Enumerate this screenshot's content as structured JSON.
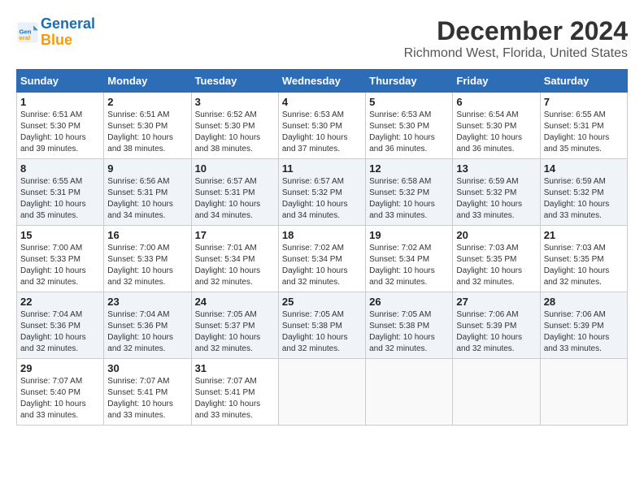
{
  "header": {
    "logo_line1": "General",
    "logo_line2": "Blue",
    "month": "December 2024",
    "location": "Richmond West, Florida, United States"
  },
  "days_of_week": [
    "Sunday",
    "Monday",
    "Tuesday",
    "Wednesday",
    "Thursday",
    "Friday",
    "Saturday"
  ],
  "weeks": [
    [
      {
        "day": "1",
        "sunrise": "6:51 AM",
        "sunset": "5:30 PM",
        "daylight": "10 hours and 39 minutes."
      },
      {
        "day": "2",
        "sunrise": "6:51 AM",
        "sunset": "5:30 PM",
        "daylight": "10 hours and 38 minutes."
      },
      {
        "day": "3",
        "sunrise": "6:52 AM",
        "sunset": "5:30 PM",
        "daylight": "10 hours and 38 minutes."
      },
      {
        "day": "4",
        "sunrise": "6:53 AM",
        "sunset": "5:30 PM",
        "daylight": "10 hours and 37 minutes."
      },
      {
        "day": "5",
        "sunrise": "6:53 AM",
        "sunset": "5:30 PM",
        "daylight": "10 hours and 36 minutes."
      },
      {
        "day": "6",
        "sunrise": "6:54 AM",
        "sunset": "5:30 PM",
        "daylight": "10 hours and 36 minutes."
      },
      {
        "day": "7",
        "sunrise": "6:55 AM",
        "sunset": "5:31 PM",
        "daylight": "10 hours and 35 minutes."
      }
    ],
    [
      {
        "day": "8",
        "sunrise": "6:55 AM",
        "sunset": "5:31 PM",
        "daylight": "10 hours and 35 minutes."
      },
      {
        "day": "9",
        "sunrise": "6:56 AM",
        "sunset": "5:31 PM",
        "daylight": "10 hours and 34 minutes."
      },
      {
        "day": "10",
        "sunrise": "6:57 AM",
        "sunset": "5:31 PM",
        "daylight": "10 hours and 34 minutes."
      },
      {
        "day": "11",
        "sunrise": "6:57 AM",
        "sunset": "5:32 PM",
        "daylight": "10 hours and 34 minutes."
      },
      {
        "day": "12",
        "sunrise": "6:58 AM",
        "sunset": "5:32 PM",
        "daylight": "10 hours and 33 minutes."
      },
      {
        "day": "13",
        "sunrise": "6:59 AM",
        "sunset": "5:32 PM",
        "daylight": "10 hours and 33 minutes."
      },
      {
        "day": "14",
        "sunrise": "6:59 AM",
        "sunset": "5:32 PM",
        "daylight": "10 hours and 33 minutes."
      }
    ],
    [
      {
        "day": "15",
        "sunrise": "7:00 AM",
        "sunset": "5:33 PM",
        "daylight": "10 hours and 32 minutes."
      },
      {
        "day": "16",
        "sunrise": "7:00 AM",
        "sunset": "5:33 PM",
        "daylight": "10 hours and 32 minutes."
      },
      {
        "day": "17",
        "sunrise": "7:01 AM",
        "sunset": "5:34 PM",
        "daylight": "10 hours and 32 minutes."
      },
      {
        "day": "18",
        "sunrise": "7:02 AM",
        "sunset": "5:34 PM",
        "daylight": "10 hours and 32 minutes."
      },
      {
        "day": "19",
        "sunrise": "7:02 AM",
        "sunset": "5:34 PM",
        "daylight": "10 hours and 32 minutes."
      },
      {
        "day": "20",
        "sunrise": "7:03 AM",
        "sunset": "5:35 PM",
        "daylight": "10 hours and 32 minutes."
      },
      {
        "day": "21",
        "sunrise": "7:03 AM",
        "sunset": "5:35 PM",
        "daylight": "10 hours and 32 minutes."
      }
    ],
    [
      {
        "day": "22",
        "sunrise": "7:04 AM",
        "sunset": "5:36 PM",
        "daylight": "10 hours and 32 minutes."
      },
      {
        "day": "23",
        "sunrise": "7:04 AM",
        "sunset": "5:36 PM",
        "daylight": "10 hours and 32 minutes."
      },
      {
        "day": "24",
        "sunrise": "7:05 AM",
        "sunset": "5:37 PM",
        "daylight": "10 hours and 32 minutes."
      },
      {
        "day": "25",
        "sunrise": "7:05 AM",
        "sunset": "5:38 PM",
        "daylight": "10 hours and 32 minutes."
      },
      {
        "day": "26",
        "sunrise": "7:05 AM",
        "sunset": "5:38 PM",
        "daylight": "10 hours and 32 minutes."
      },
      {
        "day": "27",
        "sunrise": "7:06 AM",
        "sunset": "5:39 PM",
        "daylight": "10 hours and 32 minutes."
      },
      {
        "day": "28",
        "sunrise": "7:06 AM",
        "sunset": "5:39 PM",
        "daylight": "10 hours and 33 minutes."
      }
    ],
    [
      {
        "day": "29",
        "sunrise": "7:07 AM",
        "sunset": "5:40 PM",
        "daylight": "10 hours and 33 minutes."
      },
      {
        "day": "30",
        "sunrise": "7:07 AM",
        "sunset": "5:41 PM",
        "daylight": "10 hours and 33 minutes."
      },
      {
        "day": "31",
        "sunrise": "7:07 AM",
        "sunset": "5:41 PM",
        "daylight": "10 hours and 33 minutes."
      },
      null,
      null,
      null,
      null
    ]
  ]
}
